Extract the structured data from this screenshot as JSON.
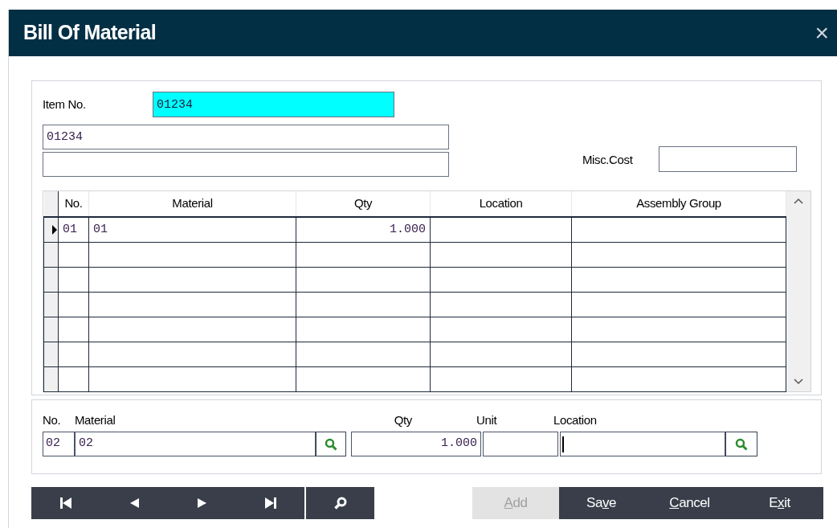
{
  "window": {
    "title": "Bill Of Material",
    "close": "×"
  },
  "header": {
    "item_no_label": "Item No.",
    "item_no": "01234",
    "description_1": "01234",
    "misc_cost_label": "Misc.Cost"
  },
  "grid": {
    "columns": [
      "No.",
      "Material",
      "Qty",
      "Location",
      "Assembly Group"
    ],
    "rows": [
      {
        "selected": true,
        "no": "01",
        "material": "01",
        "qty": "1.000"
      },
      {
        "selected": false
      },
      {
        "selected": false
      },
      {
        "selected": false
      },
      {
        "selected": false
      },
      {
        "selected": false
      },
      {
        "selected": false
      }
    ]
  },
  "entry": {
    "labels": [
      "No.",
      "Material",
      "Qty",
      "Unit",
      "Location"
    ],
    "no": "02",
    "material": "02",
    "qty": "1.000",
    "location_focused": true
  },
  "nav_buttons": [
    {
      "kind": "first"
    },
    {
      "kind": "prev"
    },
    {
      "kind": "next"
    },
    {
      "kind": "last"
    },
    {
      "kind": "find"
    }
  ],
  "action_buttons": [
    {
      "key": "A",
      "post": "dd",
      "disabled": true
    },
    {
      "pre": "Sa",
      "key": "v",
      "post": "e",
      "disabled": false
    },
    {
      "key": "C",
      "post": "ancel",
      "disabled": false
    },
    {
      "pre": "E",
      "key": "x",
      "post": "it",
      "disabled": false
    }
  ]
}
